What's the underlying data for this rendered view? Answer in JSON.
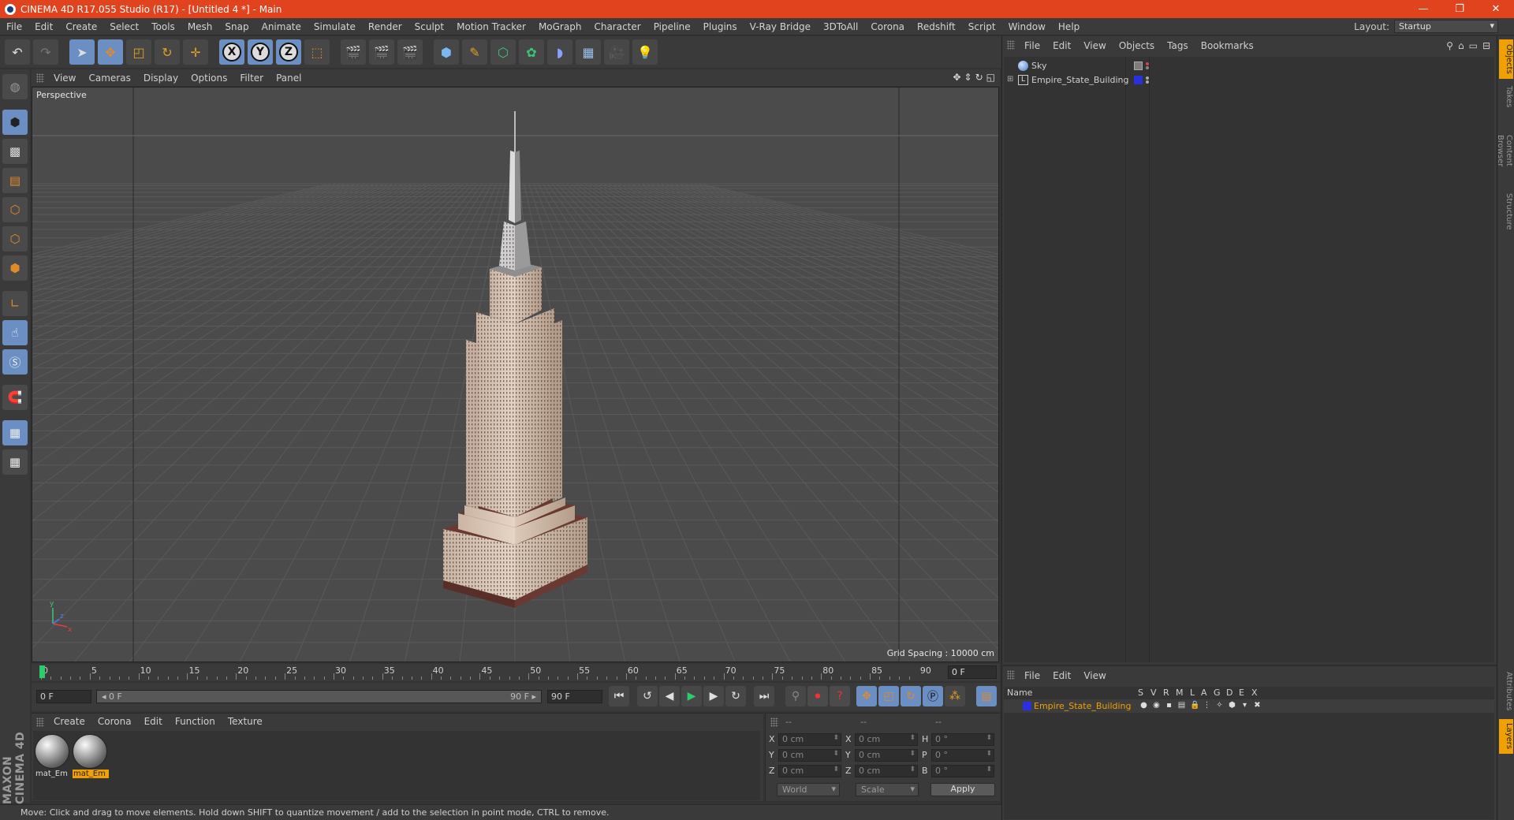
{
  "window": {
    "title": "CINEMA 4D R17.055 Studio (R17) - [Untitled 4 *] - Main",
    "minimize": "—",
    "restore": "❐",
    "close": "✕"
  },
  "menubar": {
    "items": [
      "File",
      "Edit",
      "Create",
      "Select",
      "Tools",
      "Mesh",
      "Snap",
      "Animate",
      "Simulate",
      "Render",
      "Sculpt",
      "Motion Tracker",
      "MoGraph",
      "Character",
      "Pipeline",
      "Plugins",
      "V-Ray Bridge",
      "3DToAll",
      "Corona",
      "Redshift",
      "Script",
      "Window",
      "Help"
    ],
    "layout_label": "Layout:",
    "layout_value": "Startup"
  },
  "viewport": {
    "menu": [
      "View",
      "Cameras",
      "Display",
      "Options",
      "Filter",
      "Panel"
    ],
    "label": "Perspective",
    "grid_spacing": "Grid Spacing : 10000 cm"
  },
  "timeline": {
    "ticks": [
      "0",
      "5",
      "10",
      "15",
      "20",
      "25",
      "30",
      "35",
      "40",
      "45",
      "50",
      "55",
      "60",
      "65",
      "70",
      "75",
      "80",
      "85",
      "90"
    ],
    "current_frame": "0 F"
  },
  "transport": {
    "start_field": "0 F",
    "slider_start": "◂ 0 F",
    "slider_end": "90 F ▸",
    "end_field": "90 F"
  },
  "materials": {
    "menu": [
      "Create",
      "Corona",
      "Edit",
      "Function",
      "Texture"
    ],
    "items": [
      {
        "name": "mat_Em",
        "selected": false
      },
      {
        "name": "mat_Em",
        "selected": true
      }
    ]
  },
  "coordinates": {
    "header": [
      "--",
      "--",
      "--"
    ],
    "rows": [
      {
        "a": "X",
        "av": "0 cm",
        "b": "X",
        "bv": "0 cm",
        "c": "H",
        "cv": "0 °"
      },
      {
        "a": "Y",
        "av": "0 cm",
        "b": "Y",
        "bv": "0 cm",
        "c": "P",
        "cv": "0 °"
      },
      {
        "a": "Z",
        "av": "0 cm",
        "b": "Z",
        "bv": "0 cm",
        "c": "B",
        "cv": "0 °"
      }
    ],
    "world": "World",
    "scale": "Scale",
    "apply": "Apply"
  },
  "status": "Move: Click and drag to move elements. Hold down SHIFT to quantize movement / add to the selection in point mode, CTRL to remove.",
  "objects": {
    "menu": [
      "File",
      "Edit",
      "View",
      "Objects",
      "Tags",
      "Bookmarks"
    ],
    "items": [
      {
        "name": "Sky",
        "icon": "sky-icon"
      },
      {
        "name": "Empire_State_Building",
        "icon": "null-object-icon"
      }
    ]
  },
  "layers": {
    "menu": [
      "File",
      "Edit",
      "View"
    ],
    "columns": [
      "Name",
      "S",
      "V",
      "R",
      "M",
      "L",
      "A",
      "G",
      "D",
      "E",
      "X"
    ],
    "row_name": "Empire_State_Building",
    "layer_color": "#2a2fe0"
  },
  "side_tabs": [
    "Objects",
    "Takes",
    "Content Browser",
    "Structure",
    "Attributes",
    "Layers"
  ],
  "logo_text": "MAXON CINEMA 4D",
  "colors": {
    "titlebar": "#e0431e",
    "accent_blue": "#6b8fc2",
    "selection_orange": "#f0a000"
  }
}
